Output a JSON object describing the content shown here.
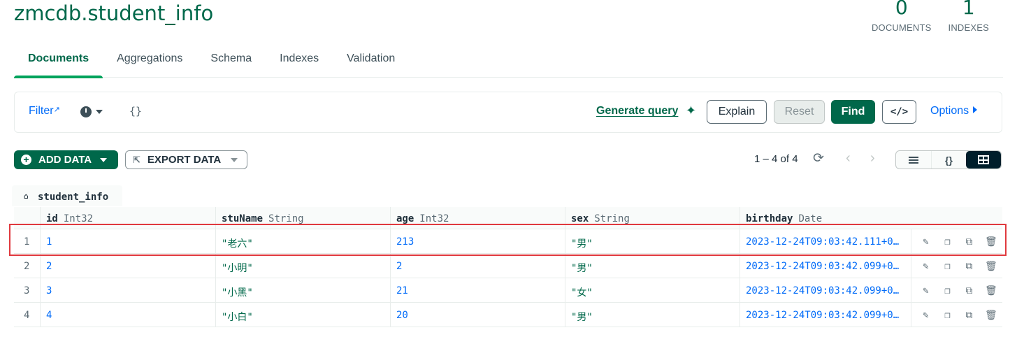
{
  "header": {
    "title": "zmcdb.student_info",
    "stats": [
      {
        "value": "0",
        "label": "DOCUMENTS"
      },
      {
        "value": "1",
        "label": "INDEXES"
      }
    ]
  },
  "tabs": [
    {
      "label": "Documents",
      "active": true
    },
    {
      "label": "Aggregations"
    },
    {
      "label": "Schema"
    },
    {
      "label": "Indexes"
    },
    {
      "label": "Validation"
    }
  ],
  "query_bar": {
    "filter_label": "Filter",
    "query_placeholder": "{}",
    "generate_query_label": "Generate query",
    "explain_label": "Explain",
    "reset_label": "Reset",
    "find_label": "Find",
    "code_label": "</>",
    "options_label": "Options"
  },
  "toolbar": {
    "add_data_label": "ADD DATA",
    "export_data_label": "EXPORT DATA",
    "pager_text": "1 – 4 of 4"
  },
  "table": {
    "collection_tab": "student_info",
    "columns": [
      {
        "name": "id",
        "type": "Int32"
      },
      {
        "name": "stuName",
        "type": "String"
      },
      {
        "name": "age",
        "type": "Int32"
      },
      {
        "name": "sex",
        "type": "String"
      },
      {
        "name": "birthday",
        "type": "Date"
      }
    ],
    "rows": [
      {
        "index": "1",
        "id": "1",
        "stuName": "\"老六\"",
        "age": "213",
        "sex": "\"男\"",
        "birthday": "2023-12-24T09:03:42.111+0…"
      },
      {
        "index": "2",
        "id": "2",
        "stuName": "\"小明\"",
        "age": "2",
        "sex": "\"男\"",
        "birthday": "2023-12-24T09:03:42.099+0…"
      },
      {
        "index": "3",
        "id": "3",
        "stuName": "\"小黑\"",
        "age": "21",
        "sex": "\"女\"",
        "birthday": "2023-12-24T09:03:42.099+0…"
      },
      {
        "index": "4",
        "id": "4",
        "stuName": "\"小白\"",
        "age": "20",
        "sex": "\"男\"",
        "birthday": "2023-12-24T09:03:42.099+0…"
      }
    ]
  },
  "colors": {
    "brand_green": "#00684a",
    "link_blue": "#016bf8",
    "highlight_red": "#e0393e"
  }
}
